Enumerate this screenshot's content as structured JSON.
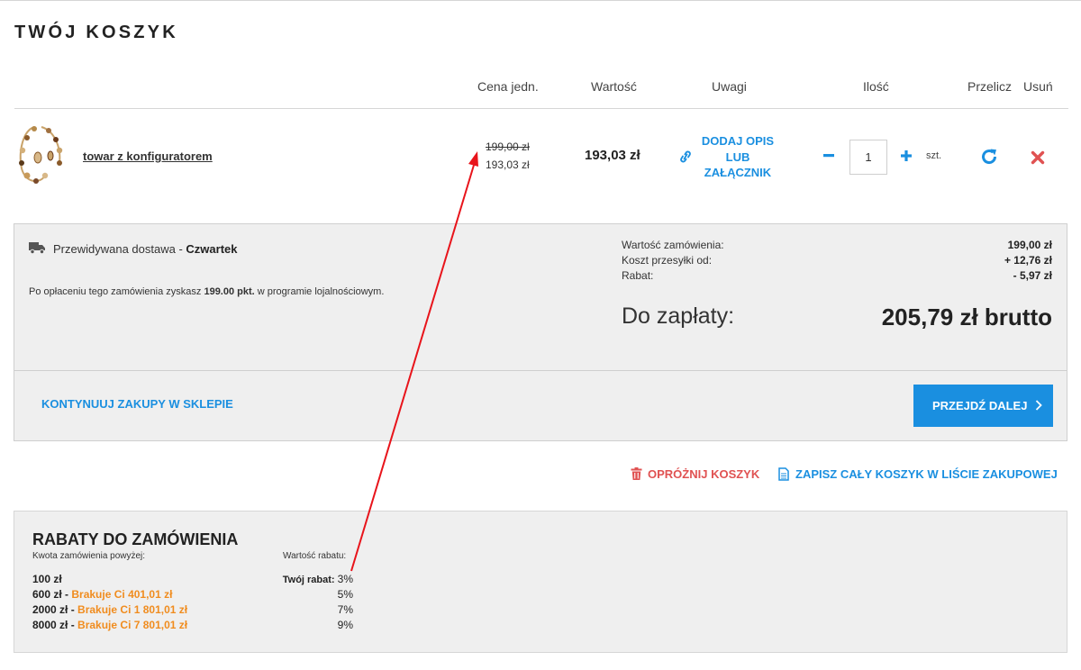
{
  "page": {
    "title": "TWÓJ KOSZYK"
  },
  "table_headers": {
    "unit_price": "Cena jedn.",
    "value": "Wartość",
    "notes": "Uwagi",
    "quantity": "Ilość",
    "recalculate": "Przelicz",
    "remove": "Usuń"
  },
  "cart_items": [
    {
      "name": "towar z konfiguratorem",
      "price_old": "199,00 zł",
      "price_new": "193,03 zł",
      "value": "193,03 zł",
      "note_link": "DODAJ OPIS LUB ZAŁĄCZNIK",
      "quantity": "1",
      "unit": "szt."
    }
  ],
  "delivery": {
    "label": "Przewidywana dostawa - ",
    "day": "Czwartek"
  },
  "loyalty": {
    "prefix": "Po opłaceniu tego zamówienia zyskasz ",
    "points": "199.00 pkt.",
    "suffix": " w programie lojalnościowym."
  },
  "summary": {
    "order_value_label": "Wartość zamówienia:",
    "order_value": "199,00 zł",
    "shipping_label": "Koszt przesyłki od:",
    "shipping": "+ 12,76 zł",
    "discount_label": "Rabat:",
    "discount": "- 5,97 zł",
    "to_pay_label": "Do zapłaty:",
    "to_pay": "205,79 zł brutto"
  },
  "actions": {
    "continue_shopping": "KONTYNUUJ ZAKUPY W SKLEPIE",
    "proceed": "PRZEJDŹ DALEJ",
    "empty_cart": "OPRÓŻNIJ KOSZYK",
    "save_to_list": "ZAPISZ CAŁY KOSZYK W LIŚCIE ZAKUPOWEJ"
  },
  "discounts": {
    "title": "RABATY DO ZAMÓWIENIA",
    "col_amount": "Kwota zamówienia powyżej:",
    "col_value": "Wartość rabatu:",
    "rows": [
      {
        "amount": "100 zł",
        "missing": "",
        "pct_prefix": "Twój rabat: ",
        "pct": "3%"
      },
      {
        "amount": "600 zł",
        "missing": "Brakuje Ci 401,01 zł",
        "pct_prefix": "",
        "pct": "5%"
      },
      {
        "amount": "2000 zł",
        "missing": "Brakuje Ci 1 801,01 zł",
        "pct_prefix": "",
        "pct": "7%"
      },
      {
        "amount": "8000 zł",
        "missing": "Brakuje Ci 7 801,01 zł",
        "pct_prefix": "",
        "pct": "9%"
      }
    ]
  },
  "icons": {
    "link": "link-icon",
    "minus": "minus-icon",
    "plus": "plus-icon",
    "refresh": "refresh-icon",
    "remove": "close-icon",
    "truck": "truck-icon",
    "trash": "trash-icon",
    "document": "document-icon",
    "chevron": "chevron-right-icon"
  },
  "colors": {
    "accent": "#1a8fe0",
    "danger": "#e05252",
    "warning": "#f08c1e",
    "annotation": "#e8141b"
  }
}
